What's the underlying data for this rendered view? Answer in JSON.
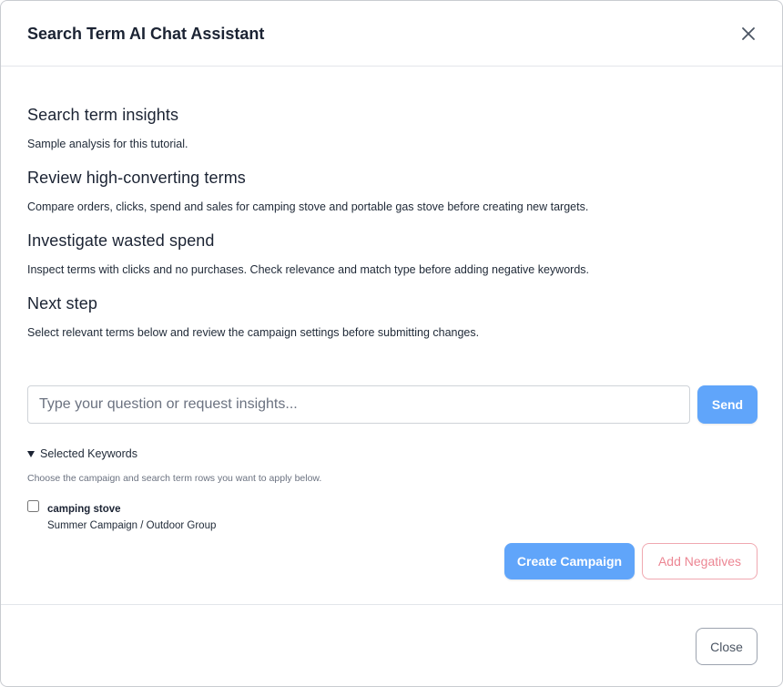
{
  "modal": {
    "title": "Search Term AI Chat Assistant"
  },
  "sections": [
    {
      "heading": "Search term insights",
      "text": "Sample analysis for this tutorial."
    },
    {
      "heading": "Review high-converting terms",
      "text": "Compare orders, clicks, spend and sales for camping stove and portable gas stove before creating new targets."
    },
    {
      "heading": "Investigate wasted spend",
      "text": "Inspect terms with clicks and no purchases. Check relevance and match type before adding negative keywords."
    },
    {
      "heading": "Next step",
      "text": "Select relevant terms below and review the campaign settings before submitting changes."
    }
  ],
  "chat": {
    "placeholder": "Type your question or request insights...",
    "value": "",
    "send_label": "Send"
  },
  "keywords": {
    "toggle_label": "Selected Keywords",
    "hint": "Choose the campaign and search term rows you want to apply below.",
    "items": [
      {
        "term": "camping stove",
        "campaign": "Summer Campaign / Outdoor Group",
        "checked": false
      }
    ]
  },
  "actions": {
    "create_campaign_label": "Create Campaign",
    "add_negatives_label": "Add Negatives"
  },
  "footer": {
    "close_label": "Close"
  },
  "icons": {
    "close": "close-icon",
    "toggle": "caret-down-icon"
  },
  "colors": {
    "primary": "#60a5fa",
    "danger_text": "#ec8693",
    "danger_border": "#f0a8b0"
  }
}
